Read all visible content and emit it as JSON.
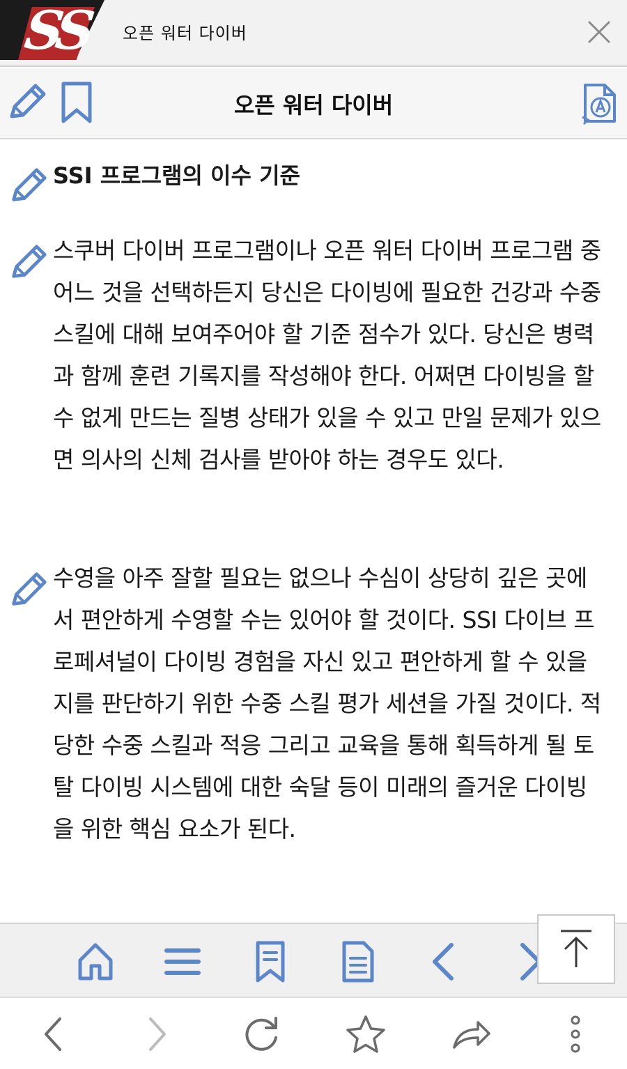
{
  "window": {
    "title": "오픈 워터 다이버",
    "logo_text": "SS"
  },
  "header": {
    "title": "오픈 워터 다이버",
    "tools": [
      "pencil-icon",
      "bookmark-icon",
      "translate-icon"
    ]
  },
  "content": {
    "heading": "SSI 프로그램의 이수 기준",
    "paragraphs": [
      "스쿠버 다이버 프로그램이나 오픈 워터 다이버 프로그램 중 어느 것을 선택하든지 당신은 다이빙에 필요한 건강과 수중 스킬에 대해 보여주어야 할 기준 점수가 있다. 당신은 병력과 함께 훈련 기록지를 작성해야 한다. 어쩌면 다이빙을 할 수 없게 만드는 질병 상태가 있을 수 있고 만일 문제가 있으면 의사의 신체 검사를 받아야 하는 경우도 있다.",
      "수영을 아주 잘할 필요는 없으나 수심이 상당히 깊은 곳에서 편안하게 수영할 수는 있어야 할 것이다. SSI 다이브 프로페셔널이 다이빙 경험을 자신 있고 편안하게 할 수 있을지를 판단하기 위한 수중 스킬 평가 세션을 가질 것이다. 적당한 수중 스킬과 적응 그리고 교육을 통해 획득하게 될 토탈 다이빙 시스템에 대한 숙달 등이 미래의 즐거운 다이빙을 위한 핵심 요소가 된다."
    ]
  },
  "bottom_nav": {
    "items": [
      "home-icon",
      "menu-icon",
      "bookmarks-icon",
      "notes-icon",
      "chevron-left-icon",
      "chevron-right-icon"
    ],
    "scroll_top": "arrow-up-icon"
  },
  "browser_bar": {
    "items": [
      "back-icon",
      "forward-icon",
      "reload-icon",
      "star-icon",
      "share-icon",
      "more-icon"
    ]
  },
  "colors": {
    "accent": "#5b86c9",
    "logo_red": "#b4282a",
    "logo_dark": "#1b1b1b"
  }
}
